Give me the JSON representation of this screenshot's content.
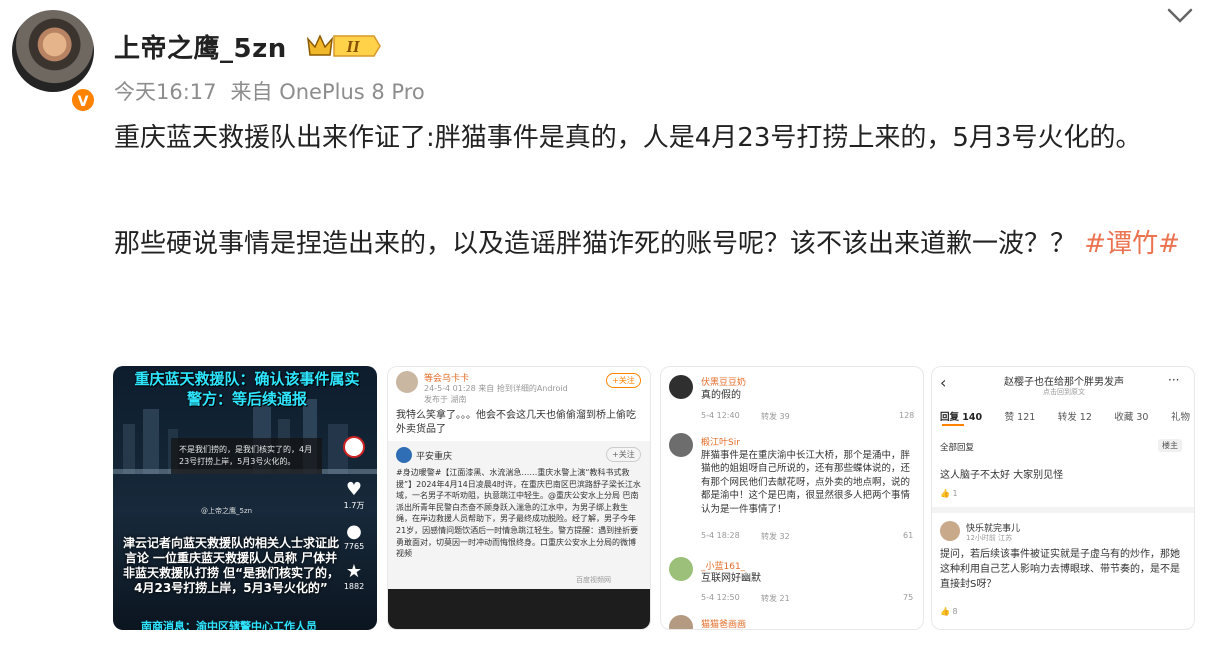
{
  "user": {
    "name": "上帝之鹰_5zn",
    "level": "II",
    "verified_mark": "V"
  },
  "meta": {
    "time": "今天16:17",
    "source": "来自 OnePlus 8 Pro"
  },
  "post": {
    "line1": "重庆蓝天救援队出来作证了:胖猫事件是真的，人是4月23号打捞上来的，5月3号火化的。",
    "line2_text": "那些硬说事情是捏造出来的，以及造谣胖猫诈死的账号呢？该不该出来道歉一波？？",
    "hashtag": "#谭竹#"
  },
  "thumb1": {
    "headline1": "重庆蓝天救援队：确认该事件属实",
    "headline2": "警方：等后续通报",
    "subtitle": "不是我们捞的，是我们核实了的，4月23号打捞上岸，5月3号火化的。",
    "watermark": "@上帝之鹰_5zn",
    "caption": "津云记者向蓝天救援队的相关人士求证此言论 一位重庆蓝天救援队人员称 尸体并非蓝天救援队打捞 但“是我们核实了的，4月23号打捞上岸，5月3号火化的”",
    "bottom": "南商消息：渝中区辖警中心工作人员",
    "count_like": "1.7万",
    "count_comment": "7765",
    "count_star": "1882"
  },
  "thumb2": {
    "user": "等会乌卡卡",
    "time": "24-5-4 01:28 来自 抢到详细的Android",
    "sent": "发布于 湖南",
    "follow": "+关注",
    "comment": "我特么笑拿了。。。他会不会这几天也偷偷溜到桥上偷吃外卖货品了",
    "repost_user": "平安重庆",
    "repost_text": "#身边暖警#【江面漆黑、水流湍急……重庆水警上演“教科书式救援”】2024年4月14日凌晨4时许，在重庆巴南区巴滨路舒子梁长江水域，一名男子不听劝阻，执意跳江中轻生。@重庆公安水上分局 巴南派出所青年民警白杰奋不顾身跃入湍急的江水中，为男子绑上救生绳，在岸边救援人员帮助下，男子最终成功脱险。经了解，男子今年21岁，因感情问题饮酒后一时情急跳江轻生。警方提醒：遇到挫折要勇敢面对，切莫因一时冲动而悔恨终身。口重庆公安水上分局的微博视频",
    "video_label": "百度视频网"
  },
  "thumb3": {
    "c1_user": "伏黑豆豆奶",
    "c1_text": "真的假的",
    "c1_time": "5-4 12:40",
    "c1_reply": "转发 39",
    "c1_likes": "128",
    "c2_user": "椴江叶Sir",
    "c2_text": "胖猫事件是在重庆渝中长江大桥，那个是涌中，胖猫他的姐姐呀自己所说的，还有那些蝶体说的，还有那个网民他们去献花呀，点外卖的地点啊，说的都是渝中！这个是巴南，很显然很多人把两个事情认为是一件事情了！",
    "c2_time": "5-4 18:28",
    "c2_reply": "转发 32",
    "c2_likes": "61",
    "c3_user": "_小蓝161_",
    "c3_text": "互联网好幽默",
    "c3_time": "5-4 12:50",
    "c3_reply": "转发 21",
    "c3_likes": "75",
    "c4_user": "猫猫爸画画"
  },
  "thumb4": {
    "title": "赵樱子也在给那个胖男发声",
    "subtitle": "点击回到原文",
    "tabs": [
      "回复 140",
      "赞 121",
      "转发 12",
      "收藏 30",
      "礼物"
    ],
    "section": "全部回复",
    "owner_tag": "楼主",
    "c1_text": "这人脑子不太好 大家别见怪",
    "c1_likes": "1",
    "c2_user": "快乐就完事儿",
    "c2_time": "12小时前 江苏",
    "c2_text": "提问，若后续该事件被证实就是子虚乌有的炒作，那她这种利用自己艺人影响力去博眼球、带节奏的，是不是直接封S呀？",
    "c2_likes": "8"
  }
}
